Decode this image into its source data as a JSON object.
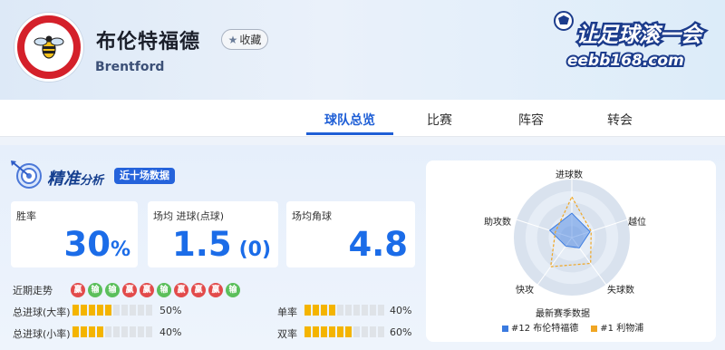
{
  "team": {
    "name_cn": "布伦特福德",
    "name_en": "Brentford",
    "favorite_label": "收藏",
    "logo_text": "BRENTFORD FOOTBALL CLUB"
  },
  "brand": {
    "slogan": "让足球滚一会",
    "site": "eebb168.com"
  },
  "tabs": [
    {
      "label": "球队总览",
      "active": true
    },
    {
      "label": "比赛",
      "active": false
    },
    {
      "label": "阵容",
      "active": false
    },
    {
      "label": "转会",
      "active": false
    }
  ],
  "analysis": {
    "title": "精准",
    "subtitle": "分析",
    "badge": "近十场数据"
  },
  "cards": {
    "win_rate": {
      "label": "胜率",
      "value": "30",
      "unit": "%"
    },
    "avg_goals": {
      "label": "场均 进球(点球)",
      "value": "1.5",
      "penalty": "(0)"
    },
    "avg_corners": {
      "label": "场均角球",
      "value": "4.8"
    }
  },
  "recent_form": {
    "label": "近期走势",
    "results": [
      "赢",
      "输",
      "输",
      "赢",
      "赢",
      "输",
      "赢",
      "赢",
      "赢",
      "输"
    ]
  },
  "stats": {
    "over_big": {
      "label": "总进球(大率)",
      "value": "50%",
      "filled": 5,
      "total": 10
    },
    "over_small": {
      "label": "总进球(小率)",
      "value": "40%",
      "filled": 4,
      "total": 10
    },
    "odd": {
      "label": "单率",
      "value": "40%",
      "filled": 4,
      "total": 10
    },
    "even": {
      "label": "双率",
      "value": "60%",
      "filled": 6,
      "total": 10
    }
  },
  "radar": {
    "axes": [
      "进球数",
      "越位",
      "失球数",
      "快攻",
      "助攻数"
    ],
    "legend_title": "最新赛季数据",
    "series": [
      {
        "name": "#12 布伦特福德",
        "color": "#3a7be0",
        "values": [
          0.42,
          0.33,
          0.22,
          0.18,
          0.4
        ]
      },
      {
        "name": "#1 利物浦",
        "color": "#f0a623",
        "values": [
          0.7,
          0.35,
          0.55,
          0.62,
          0.3
        ]
      }
    ],
    "accent": "#1f5fd6"
  }
}
